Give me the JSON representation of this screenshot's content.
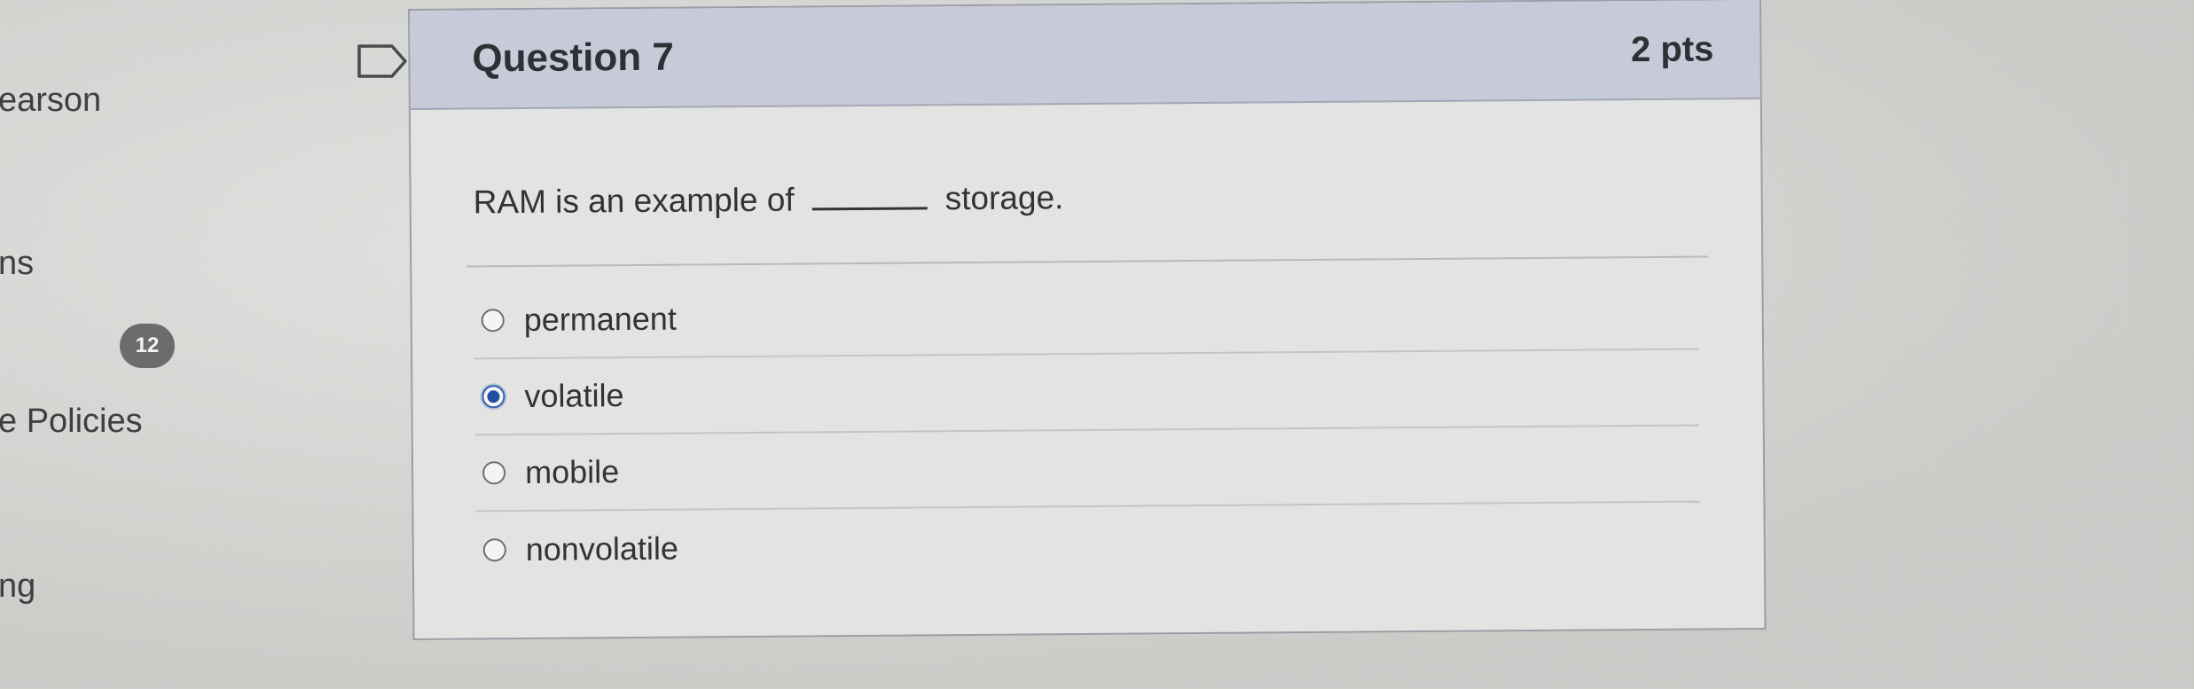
{
  "left_nav": {
    "items": [
      "earson",
      "ns",
      "e Policies",
      "ng"
    ],
    "badge_count": "12"
  },
  "question": {
    "title": "Question 7",
    "points": "2 pts",
    "text_before_blank": "RAM is an example of",
    "text_after_blank": "storage.",
    "answers": [
      {
        "label": "permanent",
        "selected": false
      },
      {
        "label": "volatile",
        "selected": true
      },
      {
        "label": "mobile",
        "selected": false
      },
      {
        "label": "nonvolatile",
        "selected": false
      }
    ]
  },
  "colors": {
    "header_bg": "#c7cad9",
    "selected_radio": "#1f4f9e",
    "card_border": "#9a9ea6"
  },
  "icons": {
    "flag": "bookmark-flag-icon",
    "radio": "radio-button-icon"
  }
}
